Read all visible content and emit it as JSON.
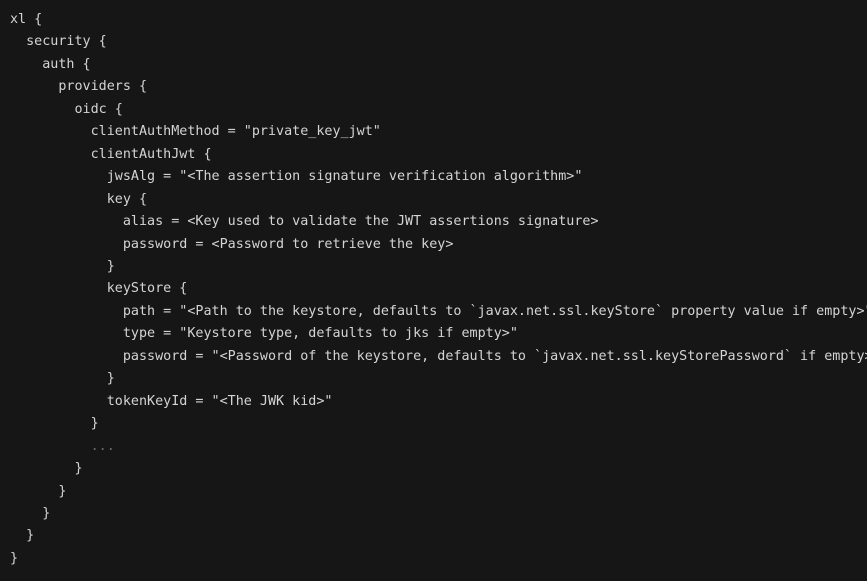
{
  "editor": {
    "language": "hocon",
    "theme": "dark",
    "background_color": "#161616",
    "text_color": "#d4d4d4",
    "dim_text_color": "#6b6b6b",
    "lines": [
      {
        "text": "xl {",
        "dim": false
      },
      {
        "text": "  security {",
        "dim": false
      },
      {
        "text": "    auth {",
        "dim": false
      },
      {
        "text": "      providers {",
        "dim": false
      },
      {
        "text": "        oidc {",
        "dim": false
      },
      {
        "text": "          clientAuthMethod = \"private_key_jwt\"",
        "dim": false
      },
      {
        "text": "          clientAuthJwt {",
        "dim": false
      },
      {
        "text": "            jwsAlg = \"<The assertion signature verification algorithm>\"",
        "dim": false
      },
      {
        "text": "            key {",
        "dim": false
      },
      {
        "text": "              alias = <Key used to validate the JWT assertions signature>",
        "dim": false
      },
      {
        "text": "              password = <Password to retrieve the key>",
        "dim": false
      },
      {
        "text": "            }",
        "dim": false
      },
      {
        "text": "            keyStore {",
        "dim": false
      },
      {
        "text": "              path = \"<Path to the keystore, defaults to `javax.net.ssl.keyStore` property value if empty>\"",
        "dim": false
      },
      {
        "text": "              type = \"Keystore type, defaults to jks if empty>\"",
        "dim": false
      },
      {
        "text": "              password = \"<Password of the keystore, defaults to `javax.net.ssl.keyStorePassword` if empty>\"",
        "dim": false
      },
      {
        "text": "            }",
        "dim": false
      },
      {
        "text": "            tokenKeyId = \"<The JWK kid>\"",
        "dim": false
      },
      {
        "text": "          }",
        "dim": false
      },
      {
        "text": "          ...",
        "dim": true
      },
      {
        "text": "        }",
        "dim": false
      },
      {
        "text": "      }",
        "dim": false
      },
      {
        "text": "    }",
        "dim": false
      },
      {
        "text": "  }",
        "dim": false
      },
      {
        "text": "}",
        "dim": false
      }
    ]
  }
}
